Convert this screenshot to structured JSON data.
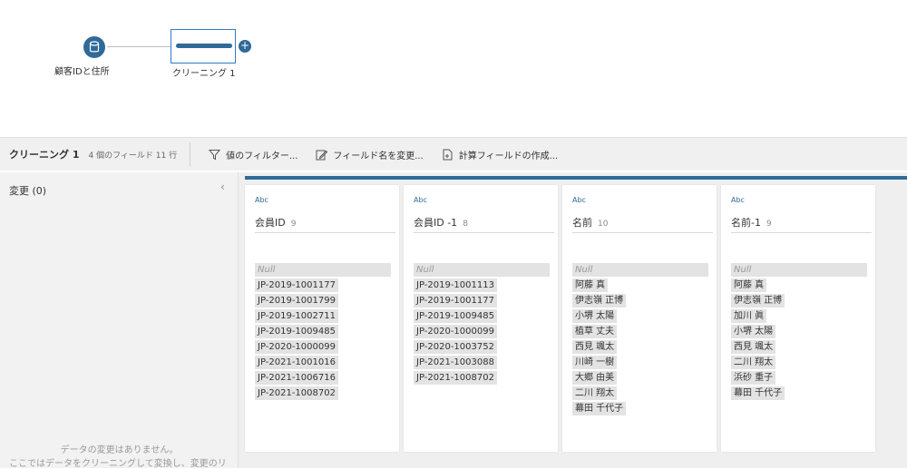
{
  "flow": {
    "input_node_label": "顧客IDと住所",
    "clean_node_label": "クリーニング 1",
    "add_symbol": "+"
  },
  "toolbar": {
    "title": "クリーニング 1",
    "meta": "4 個のフィールド  11 行",
    "filter_label": "値のフィルター...",
    "rename_label": "フィールド名を変更...",
    "calc_label": "計算フィールドの作成..."
  },
  "changes_panel": {
    "title": "変更 (0)",
    "collapse_symbol": "‹",
    "empty_line1": "データの変更はありません。",
    "empty_line2": "ここではデータをクリーニングして変換し、変更のリ"
  },
  "colors": {
    "accent": "#2f6a99",
    "selection": "#2f7cc4",
    "panel": "#f2f2f2"
  },
  "fields": [
    {
      "type": "Abc",
      "name": "会員ID",
      "count": "9",
      "values": [
        "Null",
        "JP-2019-1001177",
        "JP-2019-1001799",
        "JP-2019-1002711",
        "JP-2019-1009485",
        "JP-2020-1000099",
        "JP-2021-1001016",
        "JP-2021-1006716",
        "JP-2021-1008702"
      ]
    },
    {
      "type": "Abc",
      "name": "会員ID -1",
      "count": "8",
      "values": [
        "Null",
        "JP-2019-1001113",
        "JP-2019-1001177",
        "JP-2019-1009485",
        "JP-2020-1000099",
        "JP-2020-1003752",
        "JP-2021-1003088",
        "JP-2021-1008702"
      ]
    },
    {
      "type": "Abc",
      "name": "名前",
      "count": "10",
      "values": [
        "Null",
        "阿藤 真",
        "伊志嶺 正博",
        "小堺 太陽",
        "植草 丈夫",
        "西見 颯太",
        "川崎 一樹",
        "大郷 由美",
        "二川 翔太",
        "幕田 千代子"
      ]
    },
    {
      "type": "Abc",
      "name": "名前-1",
      "count": "9",
      "values": [
        "Null",
        "阿藤 真",
        "伊志嶺 正博",
        "加川 眞",
        "小堺 太陽",
        "西見 颯太",
        "二川 翔太",
        "浜砂 重子",
        "幕田 千代子"
      ]
    }
  ]
}
